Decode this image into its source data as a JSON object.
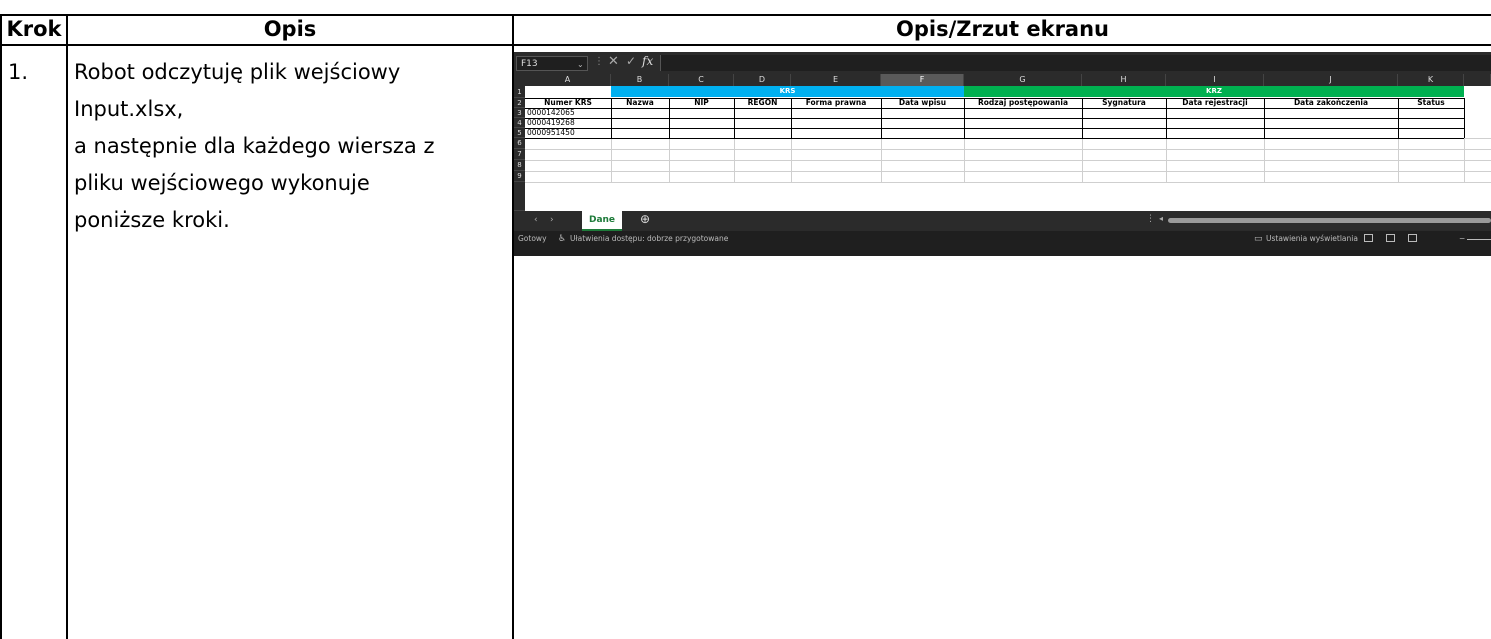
{
  "table": {
    "headers": {
      "step": "Krok",
      "description": "Opis",
      "screenshot": "Opis/Zrzut ekranu"
    },
    "row": {
      "step": "1.",
      "lines": [
        "Robot odczytuję plik wejściowy",
        "Input.xlsx,",
        "a następnie dla każdego wiersza z",
        "pliku wejściowego wykonuje",
        "poniższe kroki."
      ]
    }
  },
  "excel": {
    "name_box": "F13",
    "fx_label": "fx",
    "columns": [
      "A",
      "B",
      "C",
      "D",
      "E",
      "F",
      "G",
      "H",
      "I",
      "J",
      "K"
    ],
    "selected_column": "F",
    "rows": [
      "1",
      "2",
      "3",
      "4",
      "5",
      "6",
      "7",
      "8",
      "9"
    ],
    "group_krs": "KRS",
    "group_krz": "KRZ",
    "group_colors": {
      "krs": "#00b0f0",
      "krz": "#00b050"
    },
    "headers": [
      "Numer KRS",
      "Nazwa",
      "NIP",
      "REGON",
      "Forma prawna",
      "Data wpisu",
      "Rodzaj postępowania",
      "Sygnatura",
      "Data rejestracji",
      "Data zakończenia",
      "Status"
    ],
    "krs_numbers": [
      "0000142065",
      "0000419268",
      "0000951450"
    ],
    "sheet_tab": "Dane",
    "status_ready": "Gotowy",
    "status_accessibility": "Ułatwienia dostępu: dobrze przygotowane",
    "status_display": "Ustawienia wyświetlania"
  }
}
